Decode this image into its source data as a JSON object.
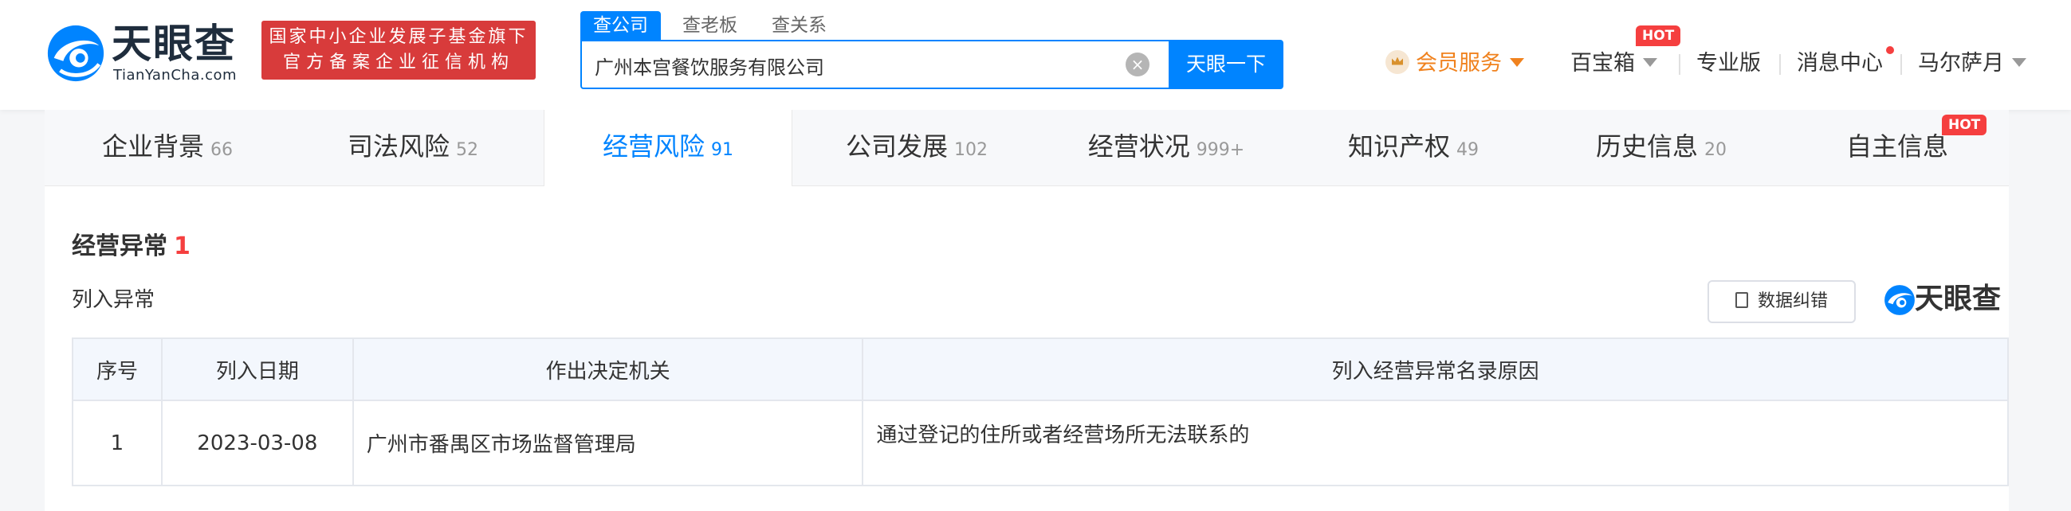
{
  "header": {
    "logo_text": "天眼查",
    "logo_sub": "TianYanCha.com",
    "badge_line1": "国家中小企业发展子基金旗下",
    "badge_line2": "官方备案企业征信机构",
    "search_tabs": [
      "查公司",
      "查老板",
      "查关系"
    ],
    "search_value": "广州本宫餐饮服务有限公司",
    "search_button": "天眼一下",
    "nav": {
      "vip": "会员服务",
      "treasure": "百宝箱",
      "treasure_badge": "HOT",
      "pro": "专业版",
      "messages": "消息中心",
      "user": "马尔萨月"
    }
  },
  "category_tabs": [
    {
      "label": "企业背景",
      "count": "66"
    },
    {
      "label": "司法风险",
      "count": "52"
    },
    {
      "label": "经营风险",
      "count": "91"
    },
    {
      "label": "公司发展",
      "count": "102"
    },
    {
      "label": "经营状况",
      "count": "999+"
    },
    {
      "label": "知识产权",
      "count": "49"
    },
    {
      "label": "历史信息",
      "count": "20"
    },
    {
      "label": "自主信息",
      "count": "",
      "badge": "HOT"
    }
  ],
  "active_tab": "经营风险",
  "section": {
    "title": "经营异常",
    "count": "1",
    "subtitle": "列入异常",
    "correct_button": "数据纠错",
    "watermark": "天眼查"
  },
  "table": {
    "headers": [
      "序号",
      "列入日期",
      "作出决定机关",
      "列入经营异常名录原因"
    ],
    "rows": [
      [
        "1",
        "2023-03-08",
        "广州市番禺区市场监督管理局",
        "通过登记的住所或者经营场所无法联系的"
      ]
    ]
  },
  "colors": {
    "brand_blue": "#0084ff",
    "badge_red": "#d83b3b",
    "vip_orange": "#f0821e",
    "hot_red": "#f53f3f"
  }
}
